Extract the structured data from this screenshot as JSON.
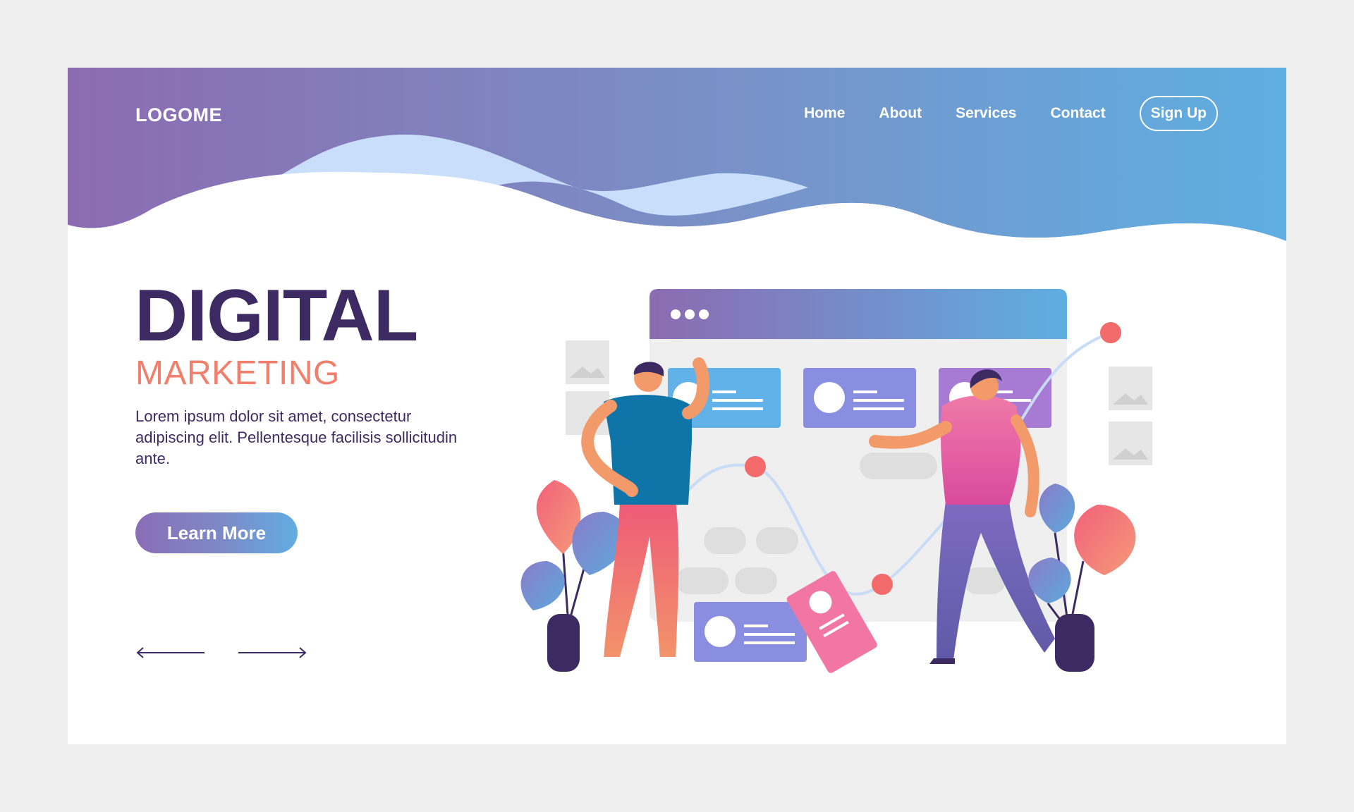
{
  "header": {
    "logo": "LOGOME",
    "nav": [
      "Home",
      "About",
      "Services",
      "Contact"
    ],
    "signup": "Sign Up"
  },
  "hero": {
    "title": "DIGITAL",
    "subtitle": "MARKETING",
    "description": "Lorem ipsum dolor sit amet, consectetur adipiscing elit. Pellentesque facilisis sollicitudin ante.",
    "cta": "Learn More"
  },
  "icons": {
    "prev": "arrow-left-icon",
    "next": "arrow-right-icon"
  },
  "colors": {
    "header_start": "#8c6bb1",
    "header_end": "#5eaee2",
    "title": "#3d2a63",
    "accent": "#f07f6b",
    "light_wave": "#c8defb"
  }
}
